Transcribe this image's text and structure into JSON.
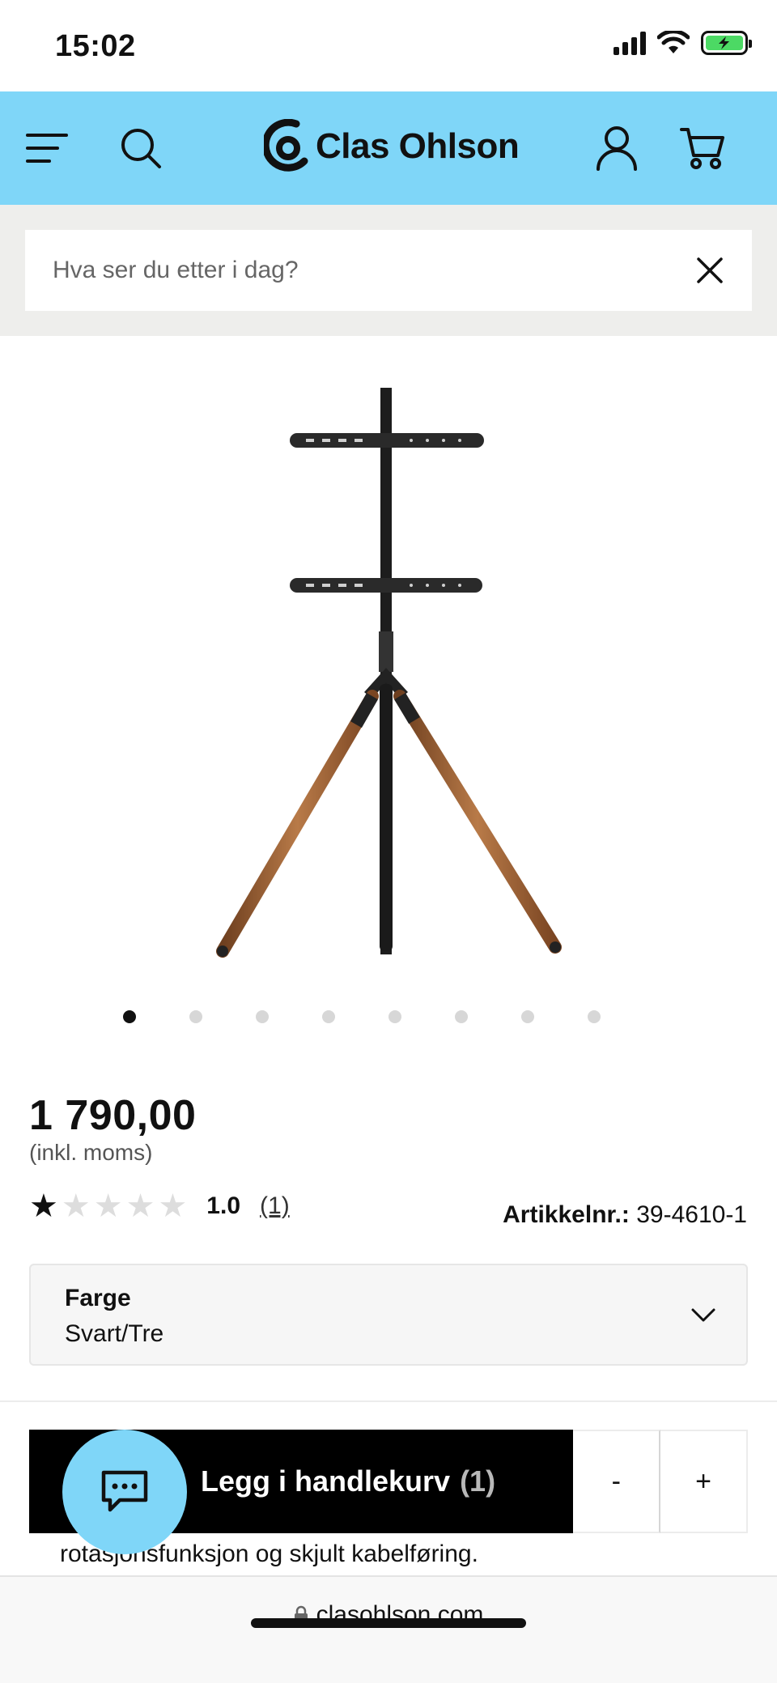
{
  "status_bar": {
    "time": "15:02"
  },
  "header": {
    "logo_text": "Clas Ohlson",
    "icons": [
      "menu-icon",
      "search-icon",
      "user-icon",
      "cart-icon"
    ],
    "background_color": "#7fd6f8"
  },
  "search": {
    "placeholder": "Hva ser du etter i dag?"
  },
  "carousel": {
    "total_images": 8,
    "active_index": 0
  },
  "product": {
    "price": "1 790,00",
    "price_note": "(inkl. moms)",
    "rating_value": "1.0",
    "rating_count": "(1)",
    "rating_stars_filled": 1,
    "rating_stars_total": 5,
    "article_label": "Artikkelnr.:",
    "article_number": "39-4610-1"
  },
  "color_selector": {
    "label": "Farge",
    "value": "Svart/Tre"
  },
  "cart": {
    "button_label": "Legg i handlekurv",
    "quantity": "(1)",
    "minus_label": "-",
    "plus_label": "+"
  },
  "description_snippet": "rotasjonsfunksjon og skjult kabelføring.",
  "browser": {
    "url": "clasohlson.com"
  }
}
